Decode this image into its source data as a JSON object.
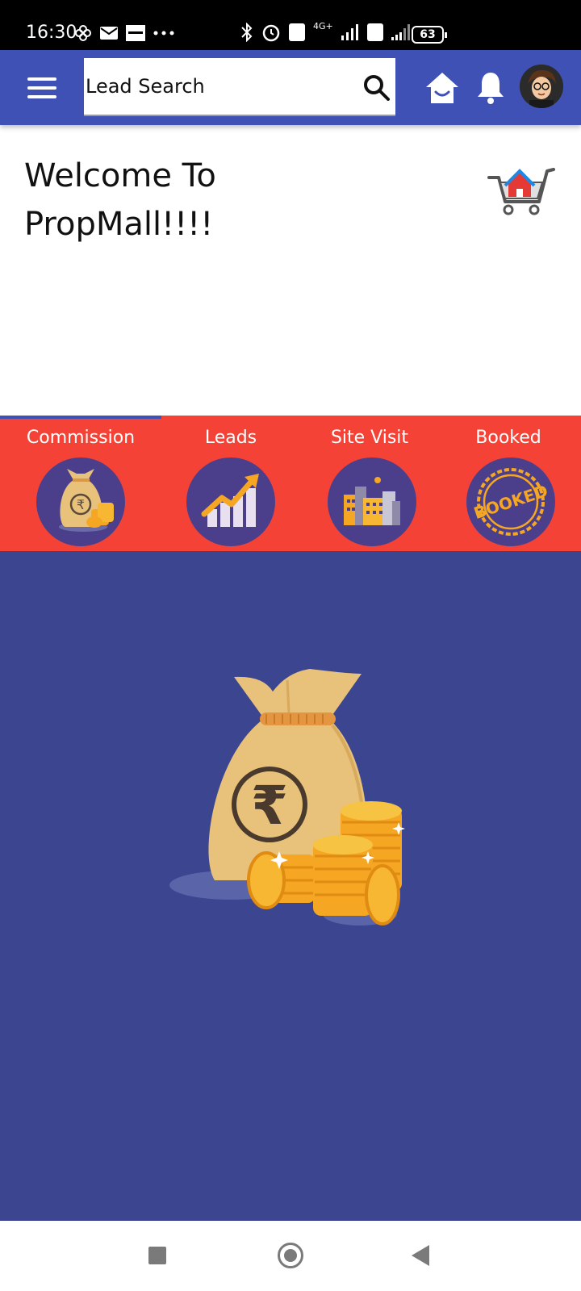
{
  "status_bar": {
    "time": "16:30",
    "network": "4G+",
    "battery": "63"
  },
  "app_bar": {
    "search_placeholder": "Lead Search"
  },
  "welcome": {
    "line1": "Welcome To",
    "line2": "PropMall!!!!"
  },
  "tabs": [
    {
      "label": "Commission"
    },
    {
      "label": "Leads"
    },
    {
      "label": "Site Visit"
    },
    {
      "label": "Booked"
    }
  ],
  "booked_stamp_text": "BOOKED",
  "colors": {
    "primary": "#3F51B5",
    "tab_bar": "#F44336",
    "content_bg": "#3B4590",
    "tab_circle": "#4B3F8C",
    "bag": "#E8C17A",
    "coin": "#F5A623"
  }
}
